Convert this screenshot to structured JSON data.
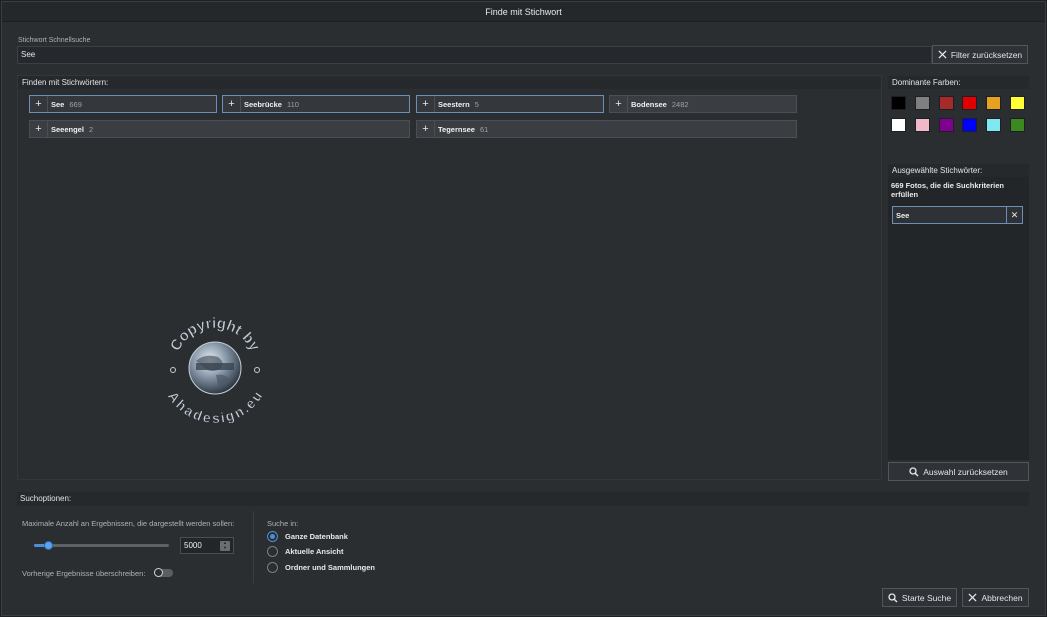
{
  "window": {
    "title": "Finde mit Stichwort"
  },
  "quick_search": {
    "label": "Stichwort Schnellsuche",
    "value": "See",
    "reset_filter_label": "Filter zurücksetzen"
  },
  "keywords": {
    "heading": "Finden mit Stichwörtern:",
    "chips": [
      {
        "name": "See",
        "count": "669",
        "active": true
      },
      {
        "name": "Seebrücke",
        "count": "110",
        "active": true
      },
      {
        "name": "Seestern",
        "count": "5",
        "active": true
      },
      {
        "name": "Bodensee",
        "count": "2482",
        "active": false
      },
      {
        "name": "Seeengel",
        "count": "2",
        "active": false
      },
      {
        "name": "Tegernsee",
        "count": "61",
        "active": false
      }
    ]
  },
  "watermark": {
    "text_top": "Copyright by",
    "text_bottom": "Ahadesign.eu"
  },
  "dominant_colors": {
    "heading": "Dominante Farben:",
    "swatches": [
      "#000000",
      "#808080",
      "#a52a2a",
      "#e00000",
      "#e8a020",
      "#ffff33",
      "#ffffff",
      "#f0b8c8",
      "#800090",
      "#0000ff",
      "#7fe8f0",
      "#3a8a20"
    ]
  },
  "selected_keywords": {
    "heading": "Ausgewählte Stichwörter:",
    "summary": "669 Fotos, die die Suchkriterien erfüllen",
    "tag": "See",
    "reset_selection_label": "Auswahl zurücksetzen"
  },
  "search_options": {
    "heading": "Suchoptionen:",
    "max_results_label": "Maximale Anzahl an Ergebnissen, die dargestellt werden sollen:",
    "max_results_value": "5000",
    "slider_fraction": 0.1,
    "overwrite_label": "Vorherige Ergebnisse überschreiben:",
    "overwrite_on": false,
    "search_in_label": "Suche in:",
    "scopes": [
      {
        "label": "Ganze Datenbank",
        "selected": true
      },
      {
        "label": "Aktuelle Ansicht",
        "selected": false
      },
      {
        "label": "Ordner und Sammlungen",
        "selected": false
      }
    ]
  },
  "footer": {
    "start_label": "Starte Suche",
    "cancel_label": "Abbrechen"
  }
}
